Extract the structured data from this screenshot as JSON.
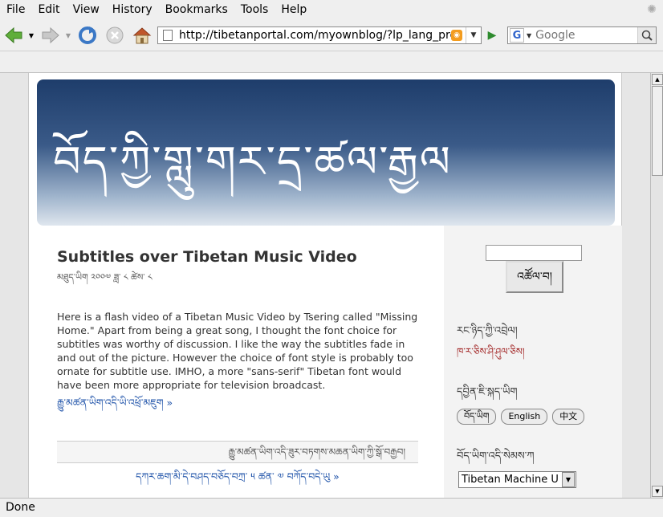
{
  "menu": {
    "file": "File",
    "edit": "Edit",
    "view": "View",
    "history": "History",
    "bookmarks": "Bookmarks",
    "tools": "Tools",
    "help": "Help"
  },
  "toolbar": {
    "url": "http://tibetanportal.com/myownblog/?lp_lang_pre",
    "search_placeholder": "Google",
    "search_engine_letter": "G"
  },
  "header": {
    "title": "བོད་ཀྱི་གླུ་གར་དྲ་ཚལ་རྒྱལ"
  },
  "post": {
    "title": "Subtitles over Tibetan Music Video",
    "meta": "མཐུད་ཡིག ༢༠༠༧ ཟླ་ ༨ ཚེས་ ༨",
    "body": "Here is a flash video of a Tibetan Music Video by Tsering called \"Missing Home.\" Apart from being a great song, I thought the font choice for subtitles was worthy of discussion. I like the way the subtitles fade in and out of the picture. However the choice of font style is probably too ornate for subtitle use. IMHO, a more \"sans-serif\" Tibetan font would have been more appropriate for television broadcast.",
    "more": "རྒྱུ་མཚན་ཡིག་འདི་ཡི་འཕྲོ་མཇུག »",
    "comment_line": "རྒྱུ་མཚན་ཡིག་འདི་ཟུར་བཏགས་མཆན་ཡིག་ཀྱི་སྒོ་བརྒྱབ།",
    "prevnext": "དཀར་ཆག་མི་དེ་བཤད་བཅོད་བཀྲ་ ༥ ཚན་ ༧ བཀོད་བདེ་ཡུ »"
  },
  "sidebar": {
    "search_button": "འཚོལ་བ།",
    "heading1": "རང་ཉིད་ཀྱི་འབྲེལ།",
    "link1": "ཁ་ར་ཅིས་ཤི་ཤུལ་ཅིས།",
    "heading2": "དབྱིན་ཇི་སྐད་ཡིག",
    "lang_tibetan": "བོད་ཡིག",
    "lang_english": "English",
    "lang_chinese": "中文",
    "heading3": "བོད་ཡིག་འདི་སེམས་ཀ",
    "font_select_value": "Tibetan Machine U"
  },
  "status": {
    "text": "Done"
  }
}
